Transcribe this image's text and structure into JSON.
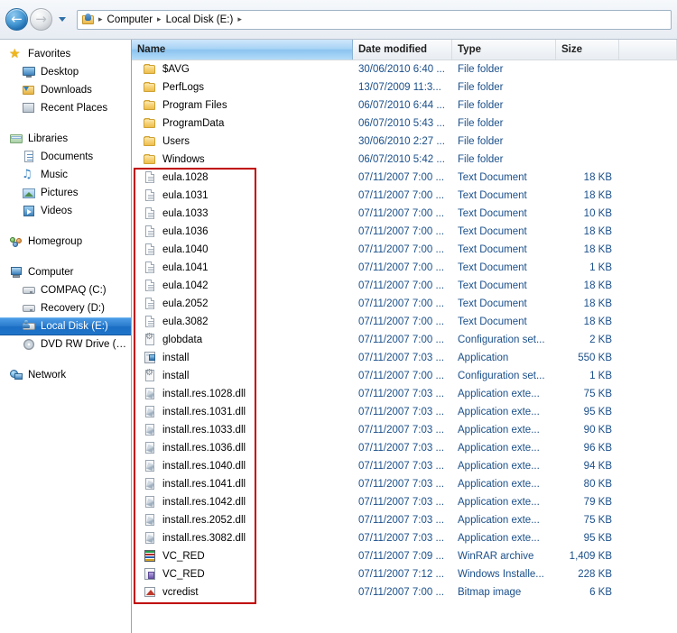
{
  "window": {
    "nav": {
      "back_label": "Back",
      "back_glyph": "←",
      "forward_label": "Forward",
      "forward_glyph": "→",
      "recent_pages_label": "Recent Pages"
    },
    "address": {
      "icon": "computer-folder-icon",
      "crumbs": [
        "Computer",
        "Local Disk (E:)"
      ],
      "separator": "▸"
    }
  },
  "sidebar": {
    "groups": [
      {
        "header": {
          "label": "Favorites",
          "icon": "star-icon",
          "name": "favorites"
        },
        "items": [
          {
            "label": "Desktop",
            "icon": "desktop-icon",
            "name": "desktop"
          },
          {
            "label": "Downloads",
            "icon": "downloads-icon",
            "name": "downloads"
          },
          {
            "label": "Recent Places",
            "icon": "recent-places-icon",
            "name": "recent-places"
          }
        ]
      },
      {
        "header": {
          "label": "Libraries",
          "icon": "libraries-icon",
          "name": "libraries"
        },
        "items": [
          {
            "label": "Documents",
            "icon": "documents-icon",
            "name": "documents"
          },
          {
            "label": "Music",
            "icon": "music-icon",
            "name": "music"
          },
          {
            "label": "Pictures",
            "icon": "pictures-icon",
            "name": "pictures"
          },
          {
            "label": "Videos",
            "icon": "videos-icon",
            "name": "videos"
          }
        ]
      },
      {
        "header": {
          "label": "Homegroup",
          "icon": "homegroup-icon",
          "name": "homegroup"
        },
        "items": []
      },
      {
        "header": {
          "label": "Computer",
          "icon": "computer-icon",
          "name": "computer"
        },
        "items": [
          {
            "label": "COMPAQ (C:)",
            "icon": "drive-icon",
            "name": "drive-c",
            "selected": false
          },
          {
            "label": "Recovery (D:)",
            "icon": "drive-icon",
            "name": "drive-d",
            "selected": false
          },
          {
            "label": "Local Disk (E:)",
            "icon": "drive-shared-icon",
            "name": "drive-e",
            "selected": true
          },
          {
            "label": "DVD RW Drive (G:) Tr",
            "icon": "dvd-drive-icon",
            "name": "drive-g",
            "selected": false
          }
        ]
      },
      {
        "header": {
          "label": "Network",
          "icon": "network-icon",
          "name": "network"
        },
        "items": []
      }
    ]
  },
  "filelist": {
    "columns": [
      {
        "label": "Name",
        "sorted": true
      },
      {
        "label": "Date modified",
        "sorted": false
      },
      {
        "label": "Type",
        "sorted": false
      },
      {
        "label": "Size",
        "sorted": false
      }
    ],
    "rows": [
      {
        "name": "$AVG",
        "date": "30/06/2010 6:40 ...",
        "type": "File folder",
        "size": "",
        "icon": "folder"
      },
      {
        "name": "PerfLogs",
        "date": "13/07/2009 11:3...",
        "type": "File folder",
        "size": "",
        "icon": "folder"
      },
      {
        "name": "Program Files",
        "date": "06/07/2010 6:44 ...",
        "type": "File folder",
        "size": "",
        "icon": "folder"
      },
      {
        "name": "ProgramData",
        "date": "06/07/2010 5:43 ...",
        "type": "File folder",
        "size": "",
        "icon": "folder"
      },
      {
        "name": "Users",
        "date": "30/06/2010 2:27 ...",
        "type": "File folder",
        "size": "",
        "icon": "folder"
      },
      {
        "name": "Windows",
        "date": "06/07/2010 5:42 ...",
        "type": "File folder",
        "size": "",
        "icon": "folder"
      },
      {
        "name": "eula.1028",
        "date": "07/11/2007 7:00 ...",
        "type": "Text Document",
        "size": "18 KB",
        "icon": "text"
      },
      {
        "name": "eula.1031",
        "date": "07/11/2007 7:00 ...",
        "type": "Text Document",
        "size": "18 KB",
        "icon": "text"
      },
      {
        "name": "eula.1033",
        "date": "07/11/2007 7:00 ...",
        "type": "Text Document",
        "size": "10 KB",
        "icon": "text"
      },
      {
        "name": "eula.1036",
        "date": "07/11/2007 7:00 ...",
        "type": "Text Document",
        "size": "18 KB",
        "icon": "text"
      },
      {
        "name": "eula.1040",
        "date": "07/11/2007 7:00 ...",
        "type": "Text Document",
        "size": "18 KB",
        "icon": "text"
      },
      {
        "name": "eula.1041",
        "date": "07/11/2007 7:00 ...",
        "type": "Text Document",
        "size": "1 KB",
        "icon": "text"
      },
      {
        "name": "eula.1042",
        "date": "07/11/2007 7:00 ...",
        "type": "Text Document",
        "size": "18 KB",
        "icon": "text"
      },
      {
        "name": "eula.2052",
        "date": "07/11/2007 7:00 ...",
        "type": "Text Document",
        "size": "18 KB",
        "icon": "text"
      },
      {
        "name": "eula.3082",
        "date": "07/11/2007 7:00 ...",
        "type": "Text Document",
        "size": "18 KB",
        "icon": "text"
      },
      {
        "name": "globdata",
        "date": "07/11/2007 7:00 ...",
        "type": "Configuration set...",
        "size": "2 KB",
        "icon": "config"
      },
      {
        "name": "install",
        "date": "07/11/2007 7:03 ...",
        "type": "Application",
        "size": "550 KB",
        "icon": "app"
      },
      {
        "name": "install",
        "date": "07/11/2007 7:00 ...",
        "type": "Configuration set...",
        "size": "1 KB",
        "icon": "config"
      },
      {
        "name": "install.res.1028.dll",
        "date": "07/11/2007 7:03 ...",
        "type": "Application exte...",
        "size": "75 KB",
        "icon": "dll"
      },
      {
        "name": "install.res.1031.dll",
        "date": "07/11/2007 7:03 ...",
        "type": "Application exte...",
        "size": "95 KB",
        "icon": "dll"
      },
      {
        "name": "install.res.1033.dll",
        "date": "07/11/2007 7:03 ...",
        "type": "Application exte...",
        "size": "90 KB",
        "icon": "dll"
      },
      {
        "name": "install.res.1036.dll",
        "date": "07/11/2007 7:03 ...",
        "type": "Application exte...",
        "size": "96 KB",
        "icon": "dll"
      },
      {
        "name": "install.res.1040.dll",
        "date": "07/11/2007 7:03 ...",
        "type": "Application exte...",
        "size": "94 KB",
        "icon": "dll"
      },
      {
        "name": "install.res.1041.dll",
        "date": "07/11/2007 7:03 ...",
        "type": "Application exte...",
        "size": "80 KB",
        "icon": "dll"
      },
      {
        "name": "install.res.1042.dll",
        "date": "07/11/2007 7:03 ...",
        "type": "Application exte...",
        "size": "79 KB",
        "icon": "dll"
      },
      {
        "name": "install.res.2052.dll",
        "date": "07/11/2007 7:03 ...",
        "type": "Application exte...",
        "size": "75 KB",
        "icon": "dll"
      },
      {
        "name": "install.res.3082.dll",
        "date": "07/11/2007 7:03 ...",
        "type": "Application exte...",
        "size": "95 KB",
        "icon": "dll"
      },
      {
        "name": "VC_RED",
        "date": "07/11/2007 7:09 ...",
        "type": "WinRAR archive",
        "size": "1,409 KB",
        "icon": "rar"
      },
      {
        "name": "VC_RED",
        "date": "07/11/2007 7:12 ...",
        "type": "Windows Installe...",
        "size": "228 KB",
        "icon": "msi"
      },
      {
        "name": "vcredist",
        "date": "07/11/2007 7:00 ...",
        "type": "Bitmap image",
        "size": "6 KB",
        "icon": "bmp"
      }
    ]
  },
  "annotation": {
    "color": "#c00000",
    "highlights_rows_from": 6,
    "highlights_rows_to": 29
  }
}
